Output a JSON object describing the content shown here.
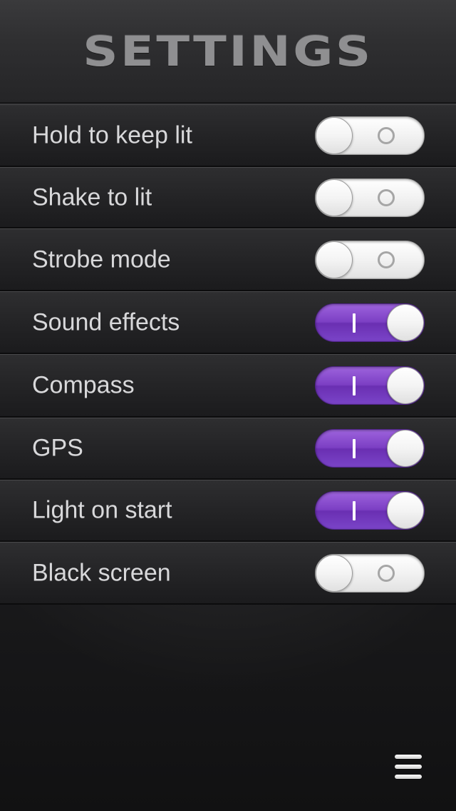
{
  "header": {
    "title": "SETTINGS"
  },
  "settings": [
    {
      "label": "Hold to keep lit",
      "enabled": false
    },
    {
      "label": "Shake to lit",
      "enabled": false
    },
    {
      "label": "Strobe mode",
      "enabled": false
    },
    {
      "label": "Sound effects",
      "enabled": true
    },
    {
      "label": "Compass",
      "enabled": true
    },
    {
      "label": "GPS",
      "enabled": true
    },
    {
      "label": "Light on start",
      "enabled": true
    },
    {
      "label": "Black screen",
      "enabled": false
    }
  ],
  "footer": {
    "menu_icon": "hamburger-menu-icon"
  },
  "colors": {
    "accent": "#7c3fc4",
    "title_text": "#8f8f91",
    "label_text": "#d8d8da",
    "background": "#1e1e20"
  }
}
